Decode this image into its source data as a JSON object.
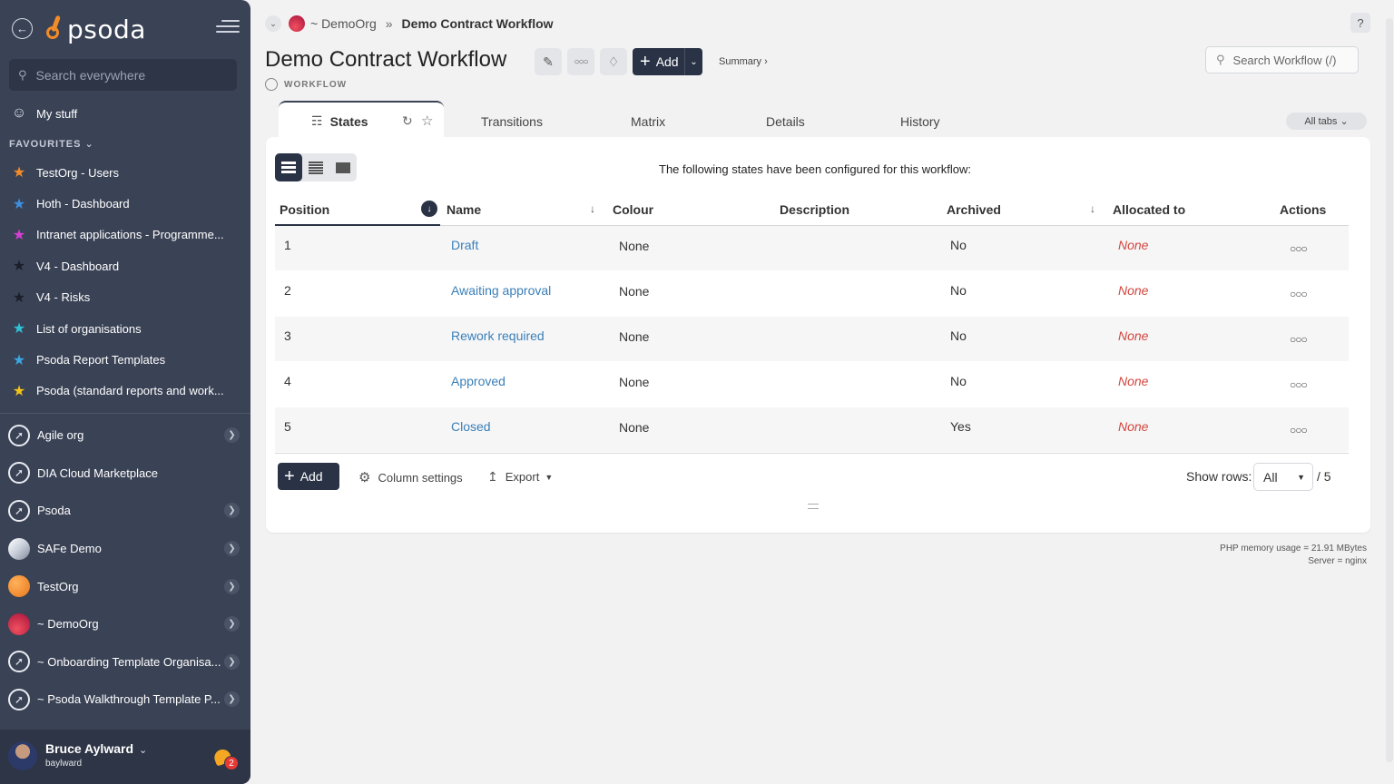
{
  "sidebar": {
    "logo": "psoda",
    "search_placeholder": "Search everywhere",
    "my_stuff": "My stuff",
    "favourites_header": "FAVOURITES",
    "favourites": [
      {
        "label": "TestOrg - Users",
        "color": "#f28c28"
      },
      {
        "label": "Hoth - Dashboard",
        "color": "#3d8fe0"
      },
      {
        "label": "Intranet applications - Programme...",
        "color": "#d63fd1"
      },
      {
        "label": "V4 - Dashboard",
        "color": "#1b1f29"
      },
      {
        "label": "V4 - Risks",
        "color": "#1b1f29"
      },
      {
        "label": "List of organisations",
        "color": "#2ec4d6"
      },
      {
        "label": "Psoda Report Templates",
        "color": "#3aa7e0"
      },
      {
        "label": "Psoda (standard reports and work...",
        "color": "#f5c518"
      }
    ],
    "orgs": [
      {
        "label": "Agile org",
        "icon": "rocket",
        "chevron": true
      },
      {
        "label": "DIA Cloud Marketplace",
        "icon": "rocket",
        "chevron": false
      },
      {
        "label": "Psoda",
        "icon": "rocket",
        "chevron": true
      },
      {
        "label": "SAFe Demo",
        "icon": "safe",
        "chevron": true
      },
      {
        "label": "TestOrg",
        "icon": "test",
        "chevron": true
      },
      {
        "label": "~ DemoOrg",
        "icon": "demo",
        "chevron": true
      },
      {
        "label": "~ Onboarding Template Organisa...",
        "icon": "rocket",
        "chevron": true
      },
      {
        "label": "~ Psoda Walkthrough Template P...",
        "icon": "rocket",
        "chevron": true
      }
    ],
    "user": {
      "name": "Bruce Aylward",
      "handle": "baylward",
      "notifications": "2"
    }
  },
  "breadcrumb": {
    "org": "~ DemoOrg",
    "current": "Demo Contract Workflow"
  },
  "help": "?",
  "page": {
    "title": "Demo Contract Workflow",
    "type_label": "WORKFLOW",
    "add_label": "Add",
    "summary_link": "Summary ›",
    "search_placeholder": "Search Workflow (/)"
  },
  "tabs": {
    "active": "States",
    "others": [
      "Transitions",
      "Matrix",
      "Details",
      "History"
    ],
    "all_tabs": "All tabs"
  },
  "panel": {
    "message": "The following states have been configured for this workflow:",
    "columns": [
      "Position",
      "Name",
      "Colour",
      "Description",
      "Archived",
      "Allocated to",
      "Actions"
    ],
    "rows": [
      {
        "position": "1",
        "name": "Draft",
        "colour": "None",
        "description": "",
        "archived": "No",
        "allocated": "None"
      },
      {
        "position": "2",
        "name": "Awaiting approval",
        "colour": "None",
        "description": "",
        "archived": "No",
        "allocated": "None"
      },
      {
        "position": "3",
        "name": "Rework required",
        "colour": "None",
        "description": "",
        "archived": "No",
        "allocated": "None"
      },
      {
        "position": "4",
        "name": "Approved",
        "colour": "None",
        "description": "",
        "archived": "No",
        "allocated": "None"
      },
      {
        "position": "5",
        "name": "Closed",
        "colour": "None",
        "description": "",
        "archived": "Yes",
        "allocated": "None"
      }
    ],
    "add_label": "Add",
    "column_settings": "Column settings",
    "export": "Export",
    "show_rows_label": "Show rows:",
    "show_rows_value": "All",
    "rows_total": "/ 5"
  },
  "footer": {
    "memory": "PHP memory usage = 21.91 MBytes",
    "server": "Server = nginx"
  }
}
